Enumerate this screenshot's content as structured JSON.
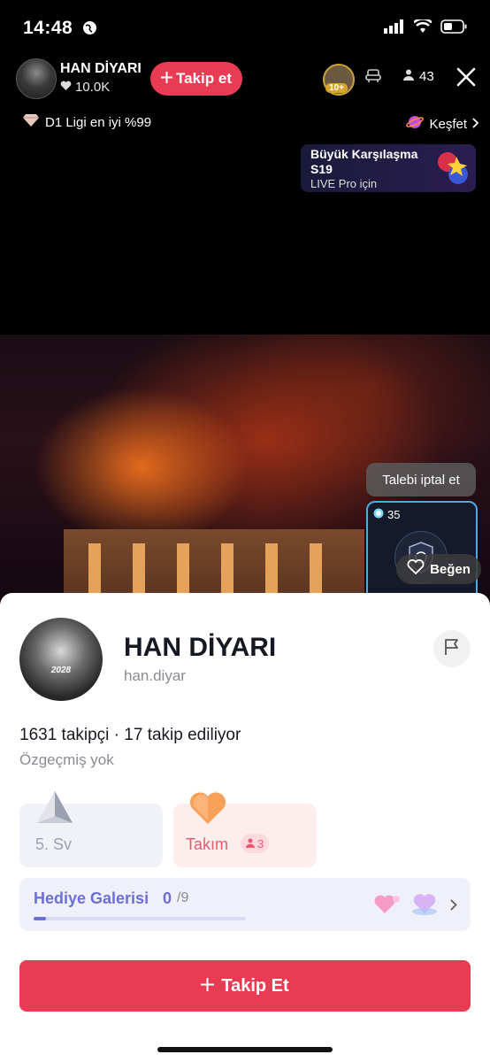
{
  "status_bar": {
    "time": "14:48"
  },
  "host": {
    "name": "HAN DİYARI",
    "likes": "10.0K",
    "follow_label": "Takip et",
    "viewer_level": "10+",
    "viewer_count": "43"
  },
  "live": {
    "league": "D1 Ligi en iyi %99",
    "explore": "Keşfet",
    "banner_title": "Büyük Karşılaşma S19",
    "banner_sub": "LIVE Pro için",
    "cancel_request": "Talebi iptal et",
    "battle_score": "35",
    "like_label": "Beğen"
  },
  "profile": {
    "avatar_text": "2028",
    "name": "HAN DİYARI",
    "handle": "han.diyar",
    "stats": "1631 takipçi · 17 takip ediliyor",
    "bio": "Özgeçmiş yok",
    "level_label": "5. Sv",
    "team_label": "Takım",
    "team_count": "3",
    "gallery_title": "Hediye Galerisi",
    "gallery_count": "0",
    "gallery_total": "/9",
    "gallery_progress": 0.06,
    "follow_button": "Takip Et"
  },
  "colors": {
    "accent": "#ea3b55",
    "gallery": "#6b6fd6"
  },
  "icons": [
    "globe-icon",
    "signal-icon",
    "wifi-icon",
    "battery-icon",
    "heart-icon",
    "plus-icon",
    "seat-icon",
    "person-icon",
    "close-icon",
    "diamond-icon",
    "planet-icon",
    "chevron-right-icon",
    "flag-icon",
    "pyramid-icon",
    "heart-badge-icon",
    "gift-icon"
  ]
}
